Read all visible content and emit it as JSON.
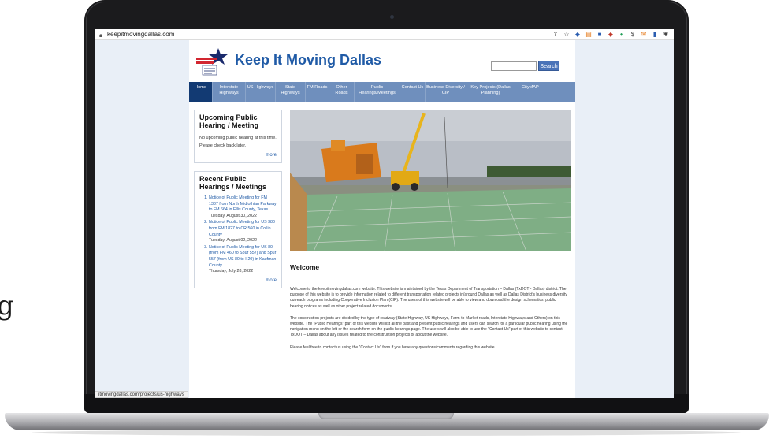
{
  "background_glyph": "g",
  "browser": {
    "url": "keepitmovingdallas.com",
    "status_link": "itmovingdallas.com/projects/us-highways",
    "extension_icons": [
      "share-icon",
      "star-icon",
      "shield-icon",
      "rss-icon",
      "puzzle-ext-icon",
      "color-ext-icon",
      "green-ext-icon",
      "dollar-ext-icon",
      "mail-ext-icon",
      "blue-ext-icon",
      "extensions-icon"
    ]
  },
  "header": {
    "logo_text": "Texas Department of Transportation",
    "title": "Keep It Moving Dallas",
    "search_placeholder": "",
    "search_button": "Search"
  },
  "nav": {
    "items": [
      {
        "label": "Home",
        "active": true
      },
      {
        "label": "Interstate Highways"
      },
      {
        "label": "US Highways"
      },
      {
        "label": "State Highways"
      },
      {
        "label": "FM Roads"
      },
      {
        "label": "Other Roads"
      },
      {
        "label": "Public Hearings/Meetings"
      },
      {
        "label": "Contact Us"
      },
      {
        "label": "Business Diversity / CIP"
      },
      {
        "label": "Key Projects (Dallas Planning)"
      },
      {
        "label": "CityMAP"
      }
    ]
  },
  "sidebar": {
    "upcoming": {
      "title": "Upcoming Public Hearing / Meeting",
      "body": "No upcoming public hearing at this time. Please check back later.",
      "more": "more"
    },
    "recent": {
      "title": "Recent Public Hearings / Meetings",
      "items": [
        {
          "link": "Notice of Public Meeting for FM 1387 from North Midlothian Parkway to FM 664 in Ellis County, Texas",
          "date": "Tuesday, August 30, 2022"
        },
        {
          "link": "Notice of Public Meeting for US 380 from FM 1827 to CR 560 in Collin County",
          "date": "Tuesday, August 02, 2022"
        },
        {
          "link": "Notice of Public Meeting for US 80 (from FM 460 to Spur 557) and Spur 557 (from US 80 to I-20) in Kaufman County",
          "date": "Thursday, July 28, 2022"
        }
      ],
      "more": "more"
    }
  },
  "main": {
    "hero_alt": "Construction site with cranes and bridge deck rebar",
    "heading": "Welcome",
    "paragraphs": [
      "Welcome to the keepitmovingdallas.com website. This website is maintained by the Texas Department of Transportation – Dallas (TxDOT - Dallas) district. The purpose of this website is to provide information related to different transportation related projects in/around Dallas as well as Dallas District's business diversity outreach programs including Cooperative Inclusion Plan (CIP). The users of this website will be able to view and download the design schematics, public hearing notices as well as other project related documents.",
      "The construction projects are divided by the type of roadway (State Highway, US Highways, Farm-to-Market roads, Interstate Highways and Others) on this website. The \"Public Hearings\" part of this website will list all the past and present public hearings and users can search for a particular public hearing using the navigation menu on the left or the search form on the public hearings page. The users will also be able to use the \"Contact Us\" part of this website to contact TxDOT – Dallas about any issues related to the construction projects or about the website.",
      "Please feel free to contact us using the \"Contact Us\" form if you have any questions/comments regarding this website."
    ]
  },
  "colors": {
    "brand_blue": "#1f5aa6",
    "nav_bg": "#6f8fbd",
    "nav_active": "#123a73",
    "screen_bg": "#e9eff7",
    "txdot_red": "#d22630",
    "txdot_navy": "#1a2a6c"
  }
}
